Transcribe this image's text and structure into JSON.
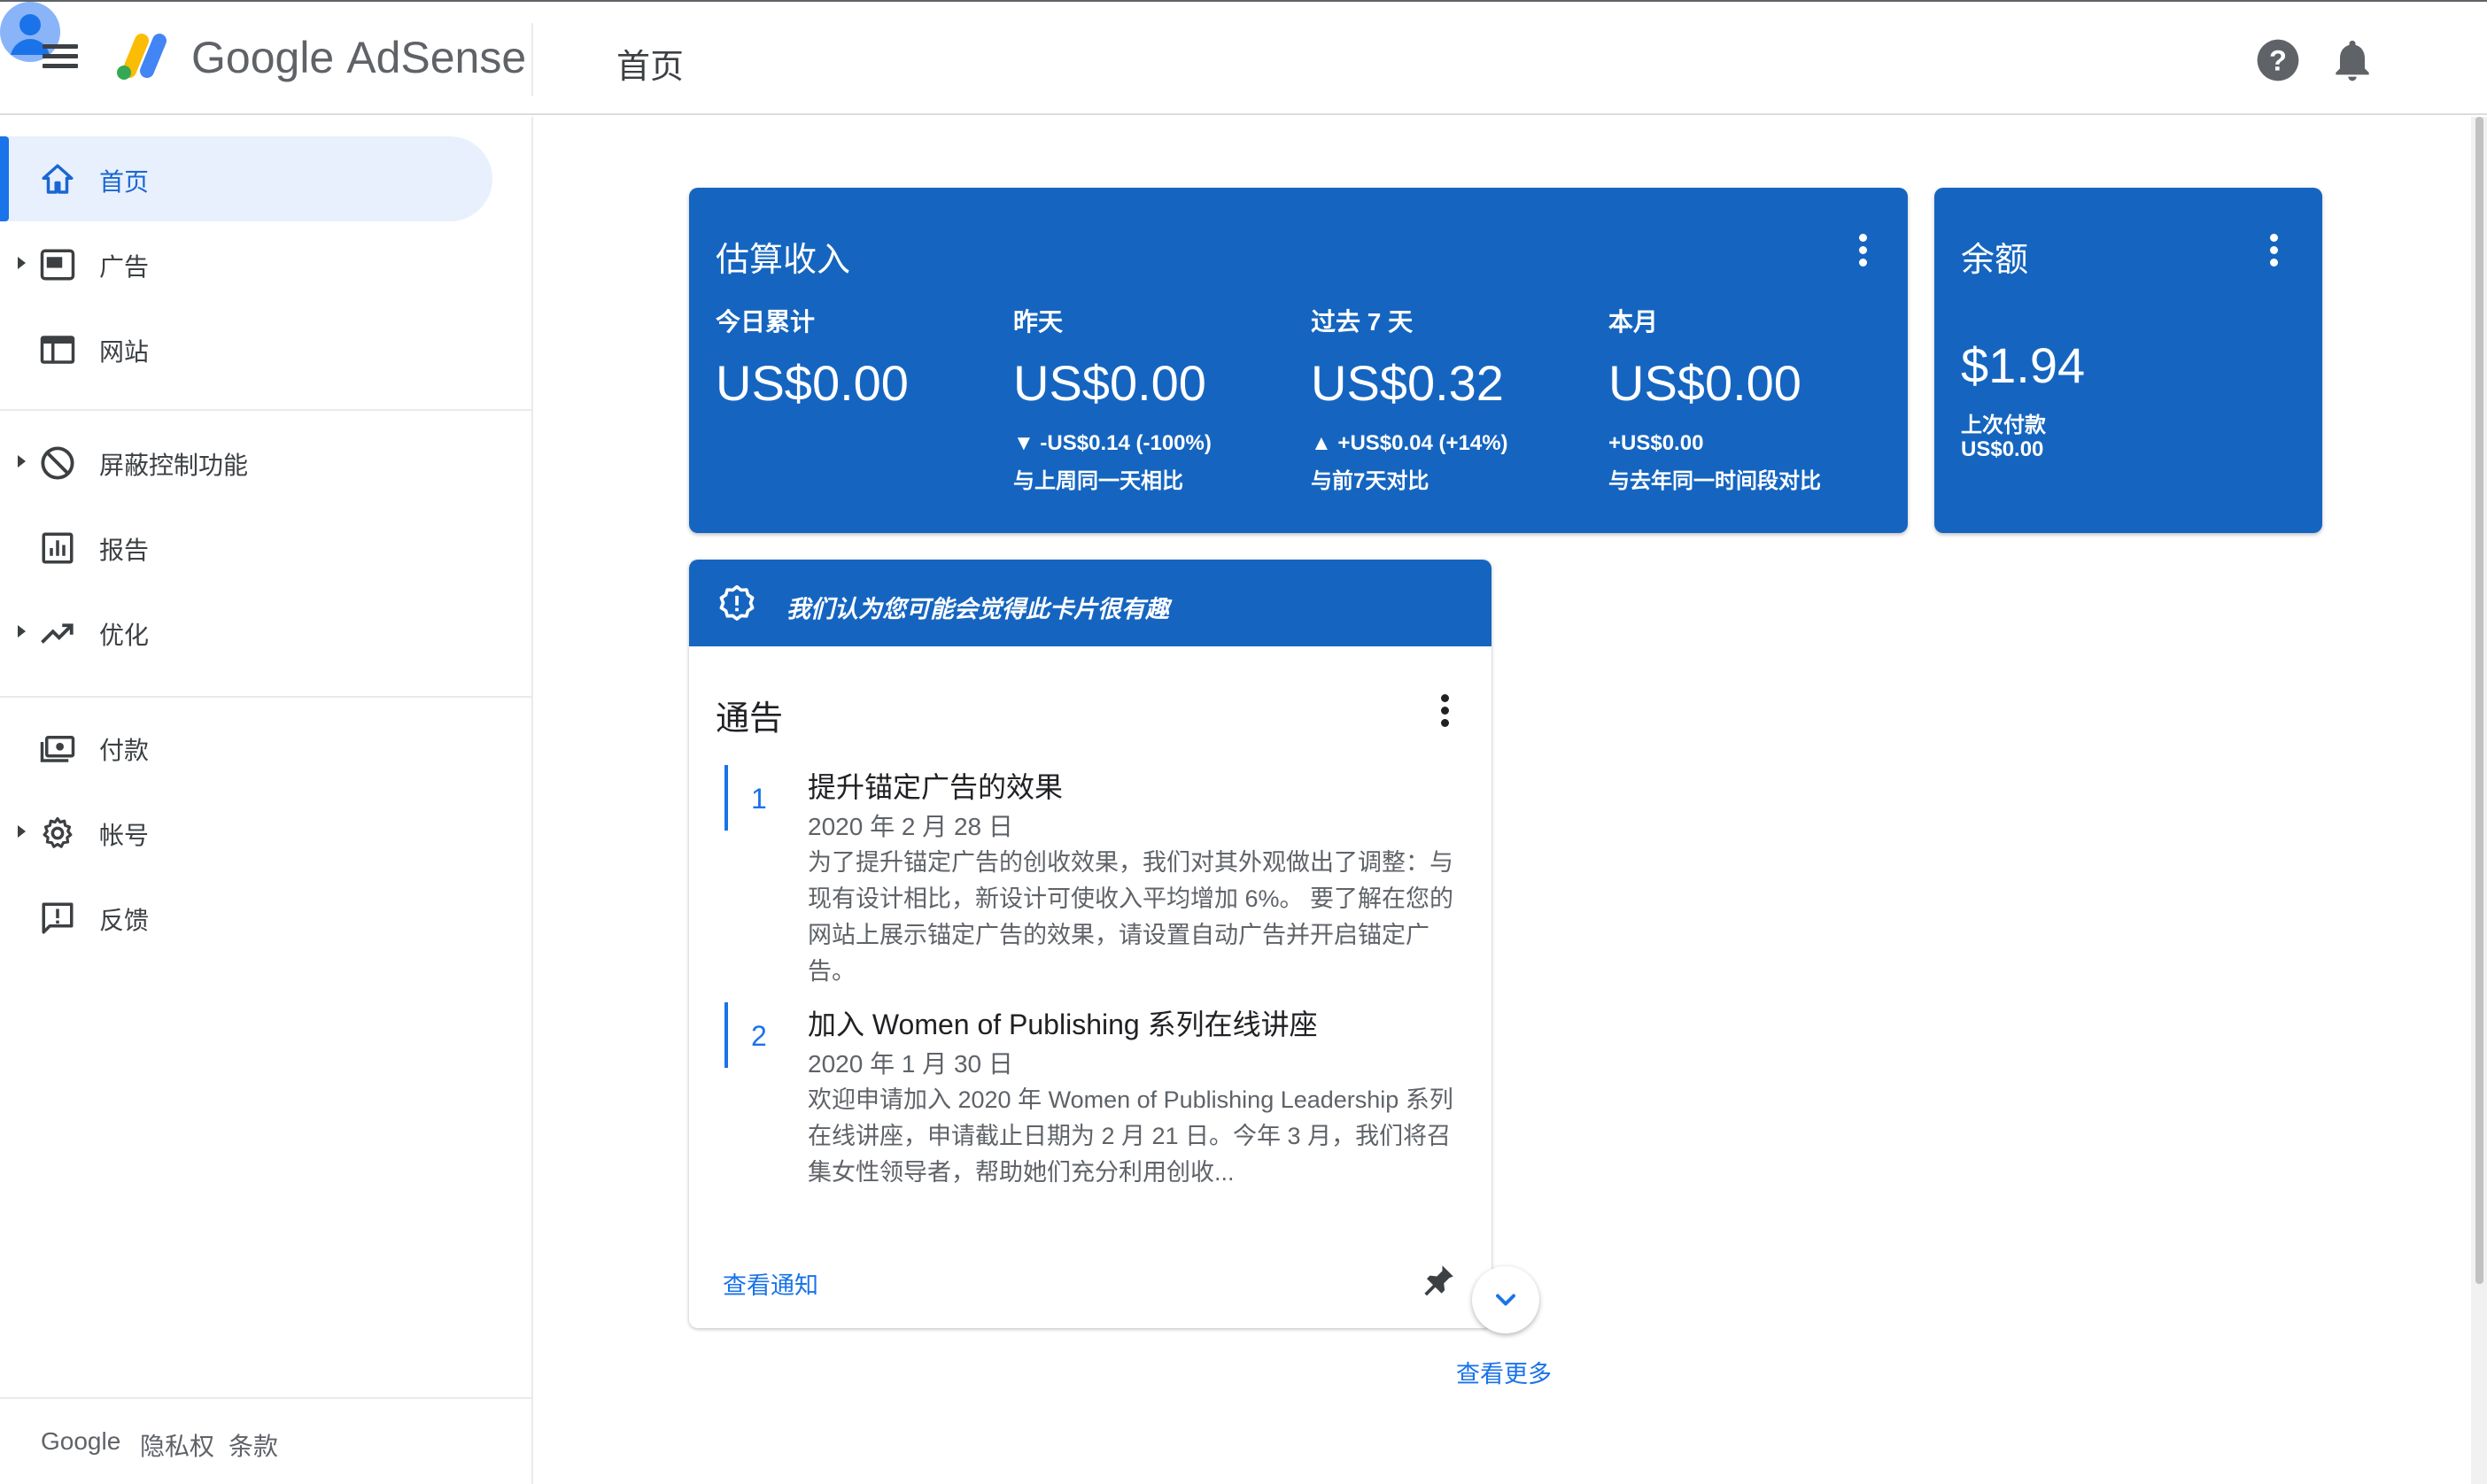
{
  "header": {
    "brand_google": "Google",
    "brand_product": "AdSense",
    "page_title": "首页"
  },
  "sidebar": {
    "items": [
      {
        "label": "首页",
        "icon": "home-icon",
        "active": true
      },
      {
        "label": "广告",
        "icon": "ads-icon"
      },
      {
        "label": "网站",
        "icon": "sites-icon"
      },
      {
        "label": "屏蔽控制功能",
        "icon": "block-icon"
      },
      {
        "label": "报告",
        "icon": "reports-icon"
      },
      {
        "label": "优化",
        "icon": "trending-up-icon"
      },
      {
        "label": "付款",
        "icon": "payments-icon"
      },
      {
        "label": "帐号",
        "icon": "gear-icon"
      },
      {
        "label": "反馈",
        "icon": "feedback-icon"
      }
    ],
    "footer": {
      "google": "Google",
      "privacy": "隐私权",
      "terms": "条款"
    }
  },
  "earnings": {
    "title": "估算收入",
    "today_label": "今日累计",
    "today_value": "US$0.00",
    "yesterday_label": "昨天",
    "yesterday_value": "US$0.00",
    "yesterday_change": "▼ -US$0.14 (-100%)",
    "yesterday_compare": "与上周同一天相比",
    "last7_label": "过去 7 天",
    "last7_value": "US$0.32",
    "last7_change": "▲ +US$0.04 (+14%)",
    "last7_compare": "与前7天对比",
    "month_label": "本月",
    "month_value": "US$0.00",
    "month_change": "+US$0.00",
    "month_compare": "与去年同一时间段对比"
  },
  "balance": {
    "title": "余额",
    "value": "$1.94",
    "last_payment_label": "上次付款",
    "last_payment_value": "US$0.00"
  },
  "announcements": {
    "banner": "我们认为您可能会觉得此卡片很有趣",
    "title": "通告",
    "items": [
      {
        "num": "1",
        "title": "提升锚定广告的效果",
        "date": "2020 年 2 月 28 日",
        "body": "为了提升锚定广告的创收效果，我们对其外观做出了调整：与现有设计相比，新设计可使收入平均增加 6%。 要了解在您的网站上展示锚定广告的效果，请设置自动广告并开启锚定广告。"
      },
      {
        "num": "2",
        "title": "加入 Women of Publishing 系列在线讲座",
        "date": "2020 年 1 月 30 日",
        "body": "欢迎申请加入 2020 年 Women of Publishing Leadership 系列在线讲座，申请截止日期为 2 月 21 日。今年 3 月，我们将召集女性领导者，帮助她们充分利用创收..."
      }
    ],
    "view_link": "查看通知",
    "more_link": "查看更多"
  },
  "colors": {
    "card_blue": "#1565c0",
    "accent_blue": "#1a73e8",
    "active_nav_bg": "#e8f0fe"
  }
}
